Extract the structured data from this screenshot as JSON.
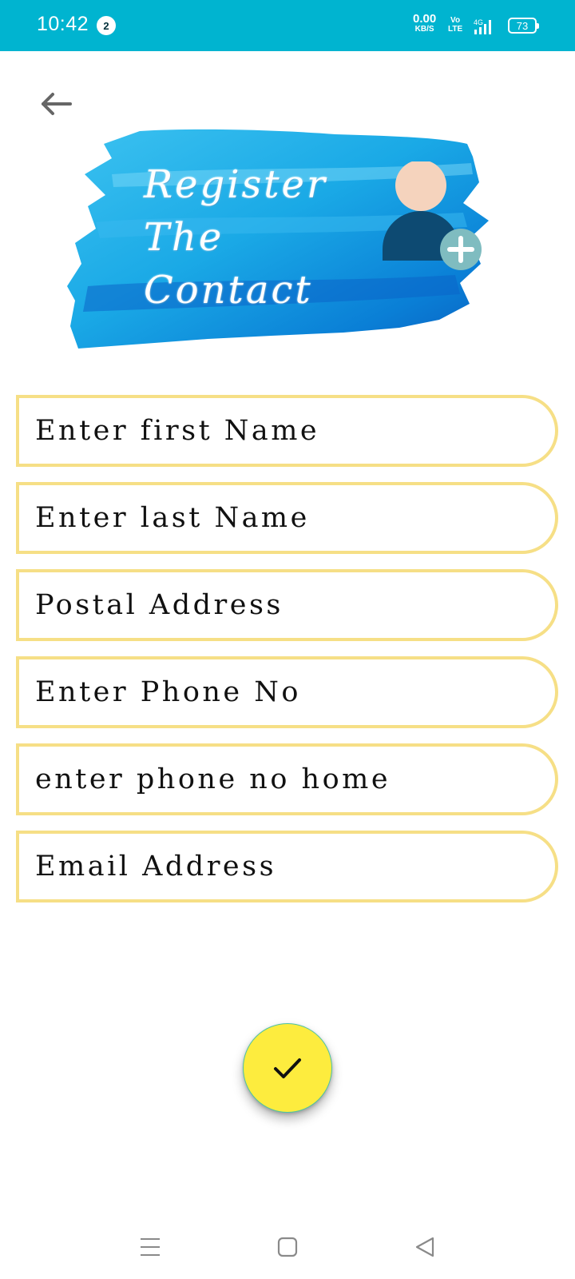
{
  "status_bar": {
    "time": "10:42",
    "notification_count": "2",
    "net_speed_value": "0.00",
    "net_speed_unit": "KB/S",
    "volte_top": "Vo",
    "volte_bottom": "LTE",
    "network_type": "4G",
    "battery_level": "73",
    "colors": {
      "background": "#00b4d0"
    }
  },
  "header": {
    "back_icon": "arrow-left-icon"
  },
  "banner": {
    "title_lines": [
      "Register",
      "The",
      "Contact"
    ],
    "icon": "add-contact-icon",
    "colors": {
      "brush": "#1aa9e6",
      "brush_dark": "#0a6fc9",
      "head": "#f5d3bd",
      "body": "#0d4a72",
      "plus_badge": "#7fbcc0"
    }
  },
  "form": {
    "fields": [
      {
        "name": "first-name",
        "value": "",
        "placeholder": "Enter first Name"
      },
      {
        "name": "last-name",
        "value": "",
        "placeholder": "Enter last Name"
      },
      {
        "name": "postal-address",
        "value": "",
        "placeholder": "Postal Address"
      },
      {
        "name": "phone",
        "value": "",
        "placeholder": "Enter Phone No"
      },
      {
        "name": "phone-home",
        "value": "",
        "placeholder": "enter phone no home"
      },
      {
        "name": "email",
        "value": "",
        "placeholder": "Email Address"
      }
    ],
    "colors": {
      "field_border": "#f6df86"
    }
  },
  "fab": {
    "icon": "checkmark-icon",
    "colors": {
      "background": "#fdec3e"
    }
  },
  "nav_bar": {
    "buttons": [
      {
        "icon": "menu-icon"
      },
      {
        "icon": "home-square-icon"
      },
      {
        "icon": "back-triangle-icon"
      }
    ]
  }
}
